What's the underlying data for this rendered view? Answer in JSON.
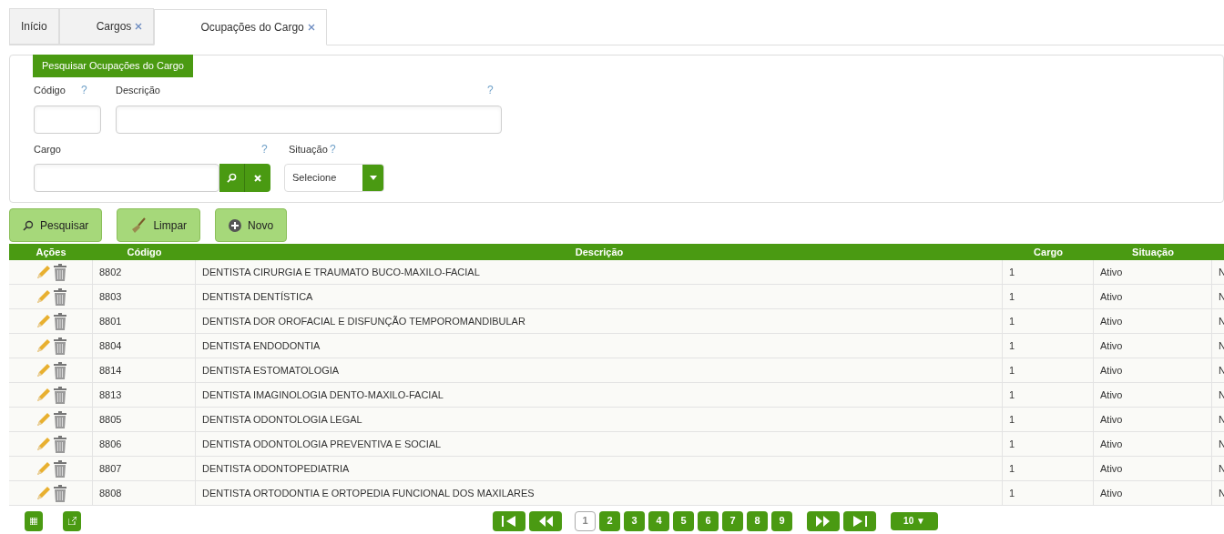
{
  "tabs": [
    {
      "label": "Início",
      "closable": false,
      "selected": false
    },
    {
      "label": "Cargos",
      "closable": true,
      "selected": false
    },
    {
      "label": "Ocupações do Cargo",
      "closable": true,
      "selected": true
    }
  ],
  "search_panel": {
    "title": "Pesquisar Ocupações do Cargo",
    "help": "?",
    "codigo": {
      "label": "Código"
    },
    "descricao": {
      "label": "Descrição"
    },
    "cargo": {
      "label": "Cargo"
    },
    "situacao": {
      "label": "Situação",
      "value": "Selecione"
    }
  },
  "buttons": [
    {
      "kind": "search",
      "label": "Pesquisar"
    },
    {
      "kind": "clear",
      "label": "Limpar"
    },
    {
      "kind": "new",
      "label": "Novo"
    }
  ],
  "table": {
    "columns": [
      "Ações",
      "Código",
      "Descrição",
      "Cargo",
      "Situação"
    ],
    "rows": [
      [
        "8802",
        "DENTISTA CIRURGIA E TRAUMATO BUCO-MAXILO-FACIAL",
        "1",
        "Ativo",
        "N"
      ],
      [
        "8803",
        "DENTISTA DENTÍSTICA",
        "1",
        "Ativo",
        "N"
      ],
      [
        "8801",
        "DENTISTA DOR OROFACIAL E DISFUNÇÃO TEMPOROMANDIBULAR",
        "1",
        "Ativo",
        "N"
      ],
      [
        "8804",
        "DENTISTA ENDODONTIA",
        "1",
        "Ativo",
        "N"
      ],
      [
        "8814",
        "DENTISTA ESTOMATOLOGIA",
        "1",
        "Ativo",
        "N"
      ],
      [
        "8813",
        "DENTISTA IMAGINOLOGIA DENTO-MAXILO-FACIAL",
        "1",
        "Ativo",
        "N"
      ],
      [
        "8805",
        "DENTISTA ODONTOLOGIA LEGAL",
        "1",
        "Ativo",
        "N"
      ],
      [
        "8806",
        "DENTISTA ODONTOLOGIA PREVENTIVA E SOCIAL",
        "1",
        "Ativo",
        "N"
      ],
      [
        "8807",
        "DENTISTA ODONTOPEDIATRIA",
        "1",
        "Ativo",
        "N"
      ],
      [
        "8808",
        "DENTISTA ORTODONTIA E ORTOPEDIA FUNCIONAL DOS MAXILARES",
        "1",
        "Ativo",
        "N"
      ]
    ]
  },
  "pager": {
    "pages": [
      {
        "label": "1",
        "selected": true
      },
      {
        "label": "2",
        "selected": false
      },
      {
        "label": "3",
        "selected": false
      },
      {
        "label": "4",
        "selected": false
      },
      {
        "label": "5",
        "selected": false
      },
      {
        "label": "6",
        "selected": false
      },
      {
        "label": "7",
        "selected": false
      },
      {
        "label": "8",
        "selected": false
      },
      {
        "label": "9",
        "selected": false
      }
    ],
    "page_size": "10 ▼"
  }
}
